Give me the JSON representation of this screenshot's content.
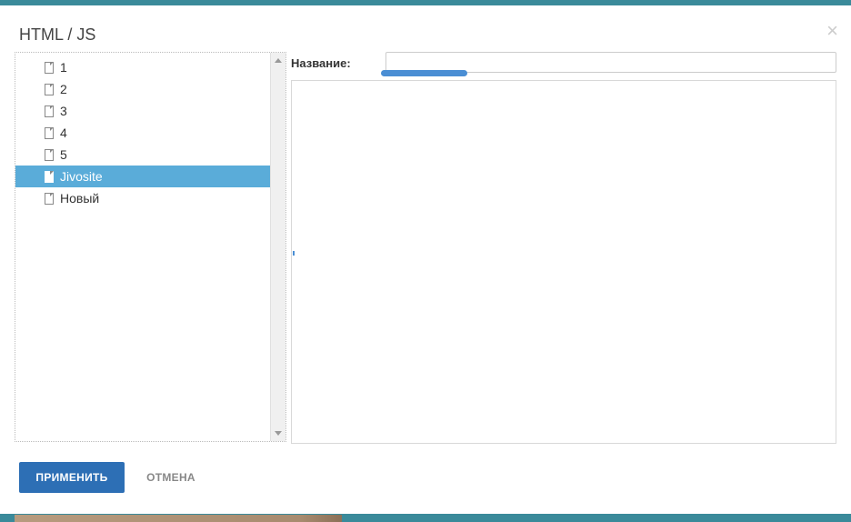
{
  "dialog": {
    "title": "HTML / JS",
    "close_glyph": "×"
  },
  "tree": {
    "items": [
      {
        "label": "1",
        "icon": "file-icon",
        "selected": false
      },
      {
        "label": "2",
        "icon": "file-icon",
        "selected": false
      },
      {
        "label": "3",
        "icon": "file-icon",
        "selected": false
      },
      {
        "label": "4",
        "icon": "file-icon",
        "selected": false
      },
      {
        "label": "5",
        "icon": "file-icon",
        "selected": false
      },
      {
        "label": "Jivosite",
        "icon": "file-icon",
        "selected": true
      },
      {
        "label": "Новый",
        "icon": "file-icon",
        "selected": false
      }
    ]
  },
  "form": {
    "name_label": "Название:",
    "name_value": ""
  },
  "buttons": {
    "apply_label": "ПРИМЕНИТЬ",
    "cancel_label": "ОТМЕНА"
  },
  "colors": {
    "accent": "#2d6fb5",
    "selected_bg": "#5aacd9",
    "loader": "#4a8ed4"
  }
}
